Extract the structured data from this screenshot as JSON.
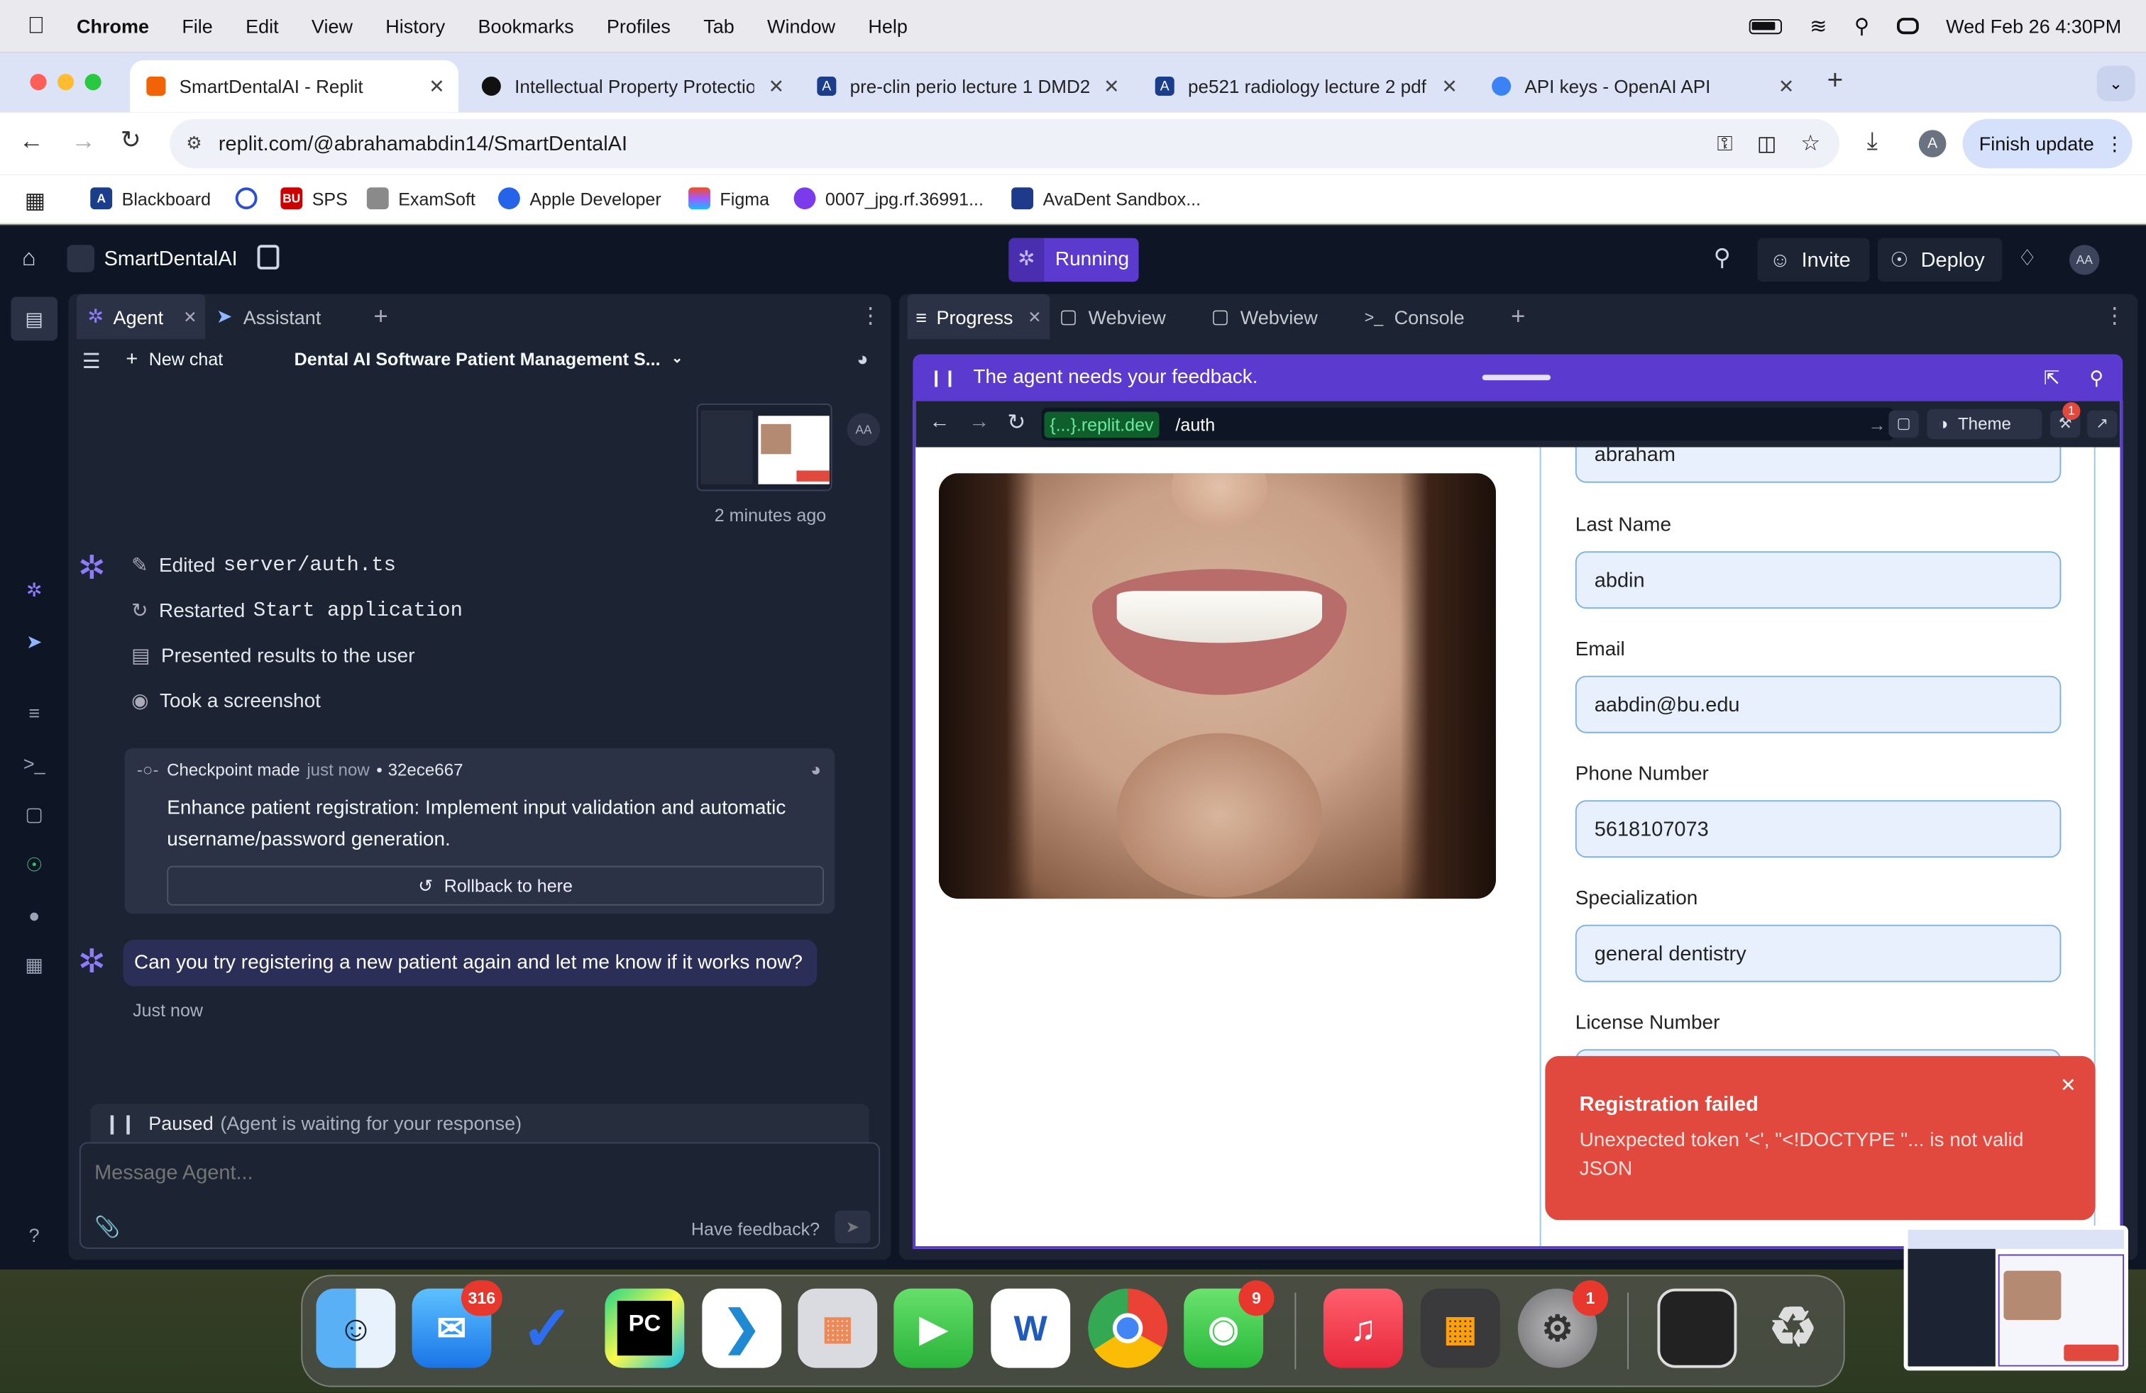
{
  "menubar": {
    "app": "Chrome",
    "items": [
      "File",
      "Edit",
      "View",
      "History",
      "Bookmarks",
      "Profiles",
      "Tab",
      "Window",
      "Help"
    ],
    "clock": "Wed Feb 26  4:30PM"
  },
  "tabs": [
    {
      "title": "SmartDentalAI - Replit"
    },
    {
      "title": "Intellectual Property Protectio"
    },
    {
      "title": "pre-clin perio lecture 1 DMD2"
    },
    {
      "title": "pe521 radiology lecture 2 pdf"
    },
    {
      "title": "API keys - OpenAI API"
    }
  ],
  "omnibox": {
    "url": "replit.com/@abrahamabdin14/SmartDentalAI",
    "finish": "Finish update"
  },
  "bookmarks": [
    "Blackboard",
    "",
    "SPS",
    "ExamSoft",
    "Apple Developer",
    "Figma",
    "0007_jpg.rf.36991...",
    "AvaDent Sandbox..."
  ],
  "replit": {
    "project": "SmartDentalAI",
    "status": "Running",
    "invite": "Invite",
    "deploy": "Deploy",
    "avatar": "AA"
  },
  "left_panel": {
    "tabs": [
      "Agent",
      "Assistant"
    ],
    "new_chat": "New chat",
    "chat_title": "Dental AI Software Patient Management S...",
    "screenshot_time": "2 minutes ago",
    "actions": [
      {
        "verb": "Edited",
        "code": "server/auth.ts"
      },
      {
        "verb": "Restarted",
        "code": "Start application"
      },
      {
        "verb": "Presented results to the user",
        "code": ""
      },
      {
        "verb": "Took a screenshot",
        "code": ""
      }
    ],
    "checkpoint": {
      "label": "Checkpoint made",
      "when": "just now",
      "sep": "•",
      "hash": "32ece667",
      "text": "Enhance patient registration: Implement input validation and automatic username/password generation.",
      "rollback": "Rollback to here"
    },
    "user_message": "Can you try registering a new patient again and let me know if it works now?",
    "user_message_time": "Just now",
    "paused": "Paused",
    "paused_note": "(Agent is waiting for your response)",
    "input_placeholder": "Message Agent...",
    "feedback": "Have feedback?"
  },
  "right_panel": {
    "tabs": [
      "Progress",
      "Webview",
      "Webview",
      "Console"
    ],
    "feedback_banner": "The agent needs your feedback.",
    "url_host": "{...}.replit.dev",
    "url_path": "/auth",
    "theme": "Theme",
    "notif_count": "1",
    "form": {
      "first_name_value": "abraham",
      "fields": [
        {
          "label": "Last Name",
          "value": "abdin"
        },
        {
          "label": "Email",
          "value": "aabdin@bu.edu"
        },
        {
          "label": "Phone Number",
          "value": "5618107073"
        },
        {
          "label": "Specialization",
          "value": "general dentistry"
        },
        {
          "label": "License Number",
          "value": ""
        }
      ]
    },
    "toast": {
      "title": "Registration failed",
      "message": "Unexpected token '<', \"<!DOCTYPE \"... is not valid JSON"
    }
  },
  "dock": {
    "badges": {
      "mail": "316",
      "messages": "9",
      "settings": "1"
    }
  },
  "colors": {
    "accent": "#5b3bcf",
    "toast": "#e1493e",
    "bg": "#0e1525",
    "panel": "#1c2333"
  }
}
